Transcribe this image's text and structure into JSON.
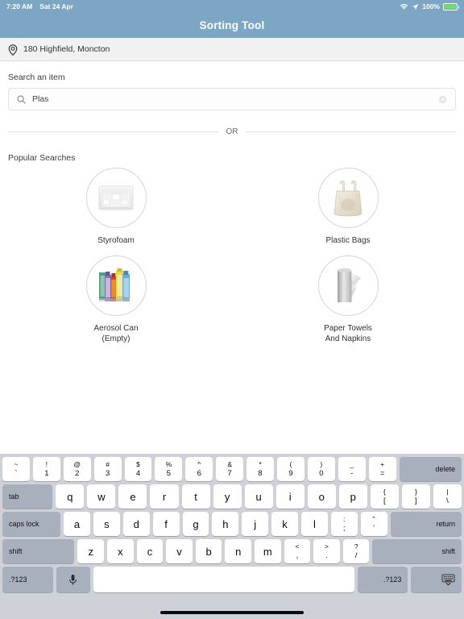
{
  "status_bar": {
    "time": "7:20 AM",
    "date": "Sat 24 Apr",
    "battery_percent": "100%",
    "wifi_icon": "wifi-icon",
    "location_arrow_icon": "location-arrow-icon",
    "battery_icon": "battery-icon"
  },
  "header": {
    "title": "Sorting Tool"
  },
  "address_bar": {
    "icon": "location-pin-icon",
    "text": "180 Highfield, Moncton"
  },
  "search": {
    "label": "Search an item",
    "value": "Plas",
    "placeholder": "Search an item",
    "search_icon": "search-icon",
    "clear_icon": "clear-circle-icon"
  },
  "divider": {
    "text": "OR"
  },
  "popular": {
    "title": "Popular Searches",
    "items": [
      {
        "label": "Styrofoam",
        "icon": "styrofoam-tray-icon"
      },
      {
        "label": "Plastic Bags",
        "icon": "plastic-bag-icon"
      },
      {
        "label": "Aerosol Can\n(Empty)",
        "line1": "Aerosol Can",
        "line2": "(Empty)",
        "icon": "aerosol-cans-icon"
      },
      {
        "label": "Paper Towels\nAnd Napkins",
        "line1": "Paper Towels",
        "line2": "And Napkins",
        "icon": "paper-towel-roll-icon"
      }
    ]
  },
  "keyboard": {
    "row1": [
      {
        "top": "~",
        "bot": "`"
      },
      {
        "top": "!",
        "bot": "1"
      },
      {
        "top": "@",
        "bot": "2"
      },
      {
        "top": "#",
        "bot": "3"
      },
      {
        "top": "$",
        "bot": "4"
      },
      {
        "top": "%",
        "bot": "5"
      },
      {
        "top": "^",
        "bot": "6"
      },
      {
        "top": "&",
        "bot": "7"
      },
      {
        "top": "*",
        "bot": "8"
      },
      {
        "top": "(",
        "bot": "9"
      },
      {
        "top": ")",
        "bot": "0"
      },
      {
        "top": "_",
        "bot": "-"
      },
      {
        "top": "+",
        "bot": "="
      }
    ],
    "delete": "delete",
    "tab": "tab",
    "row2": [
      "q",
      "w",
      "e",
      "r",
      "t",
      "y",
      "u",
      "i",
      "o",
      "p"
    ],
    "row2_dual": [
      {
        "top": "{",
        "bot": "["
      },
      {
        "top": "}",
        "bot": "]"
      },
      {
        "top": "|",
        "bot": "\\"
      }
    ],
    "caps_lock": "caps lock",
    "row3": [
      "a",
      "s",
      "d",
      "f",
      "g",
      "h",
      "j",
      "k",
      "l"
    ],
    "row3_dual": [
      {
        "top": ":",
        "bot": ";"
      },
      {
        "top": "”",
        "bot": "’"
      }
    ],
    "return": "return",
    "shift_left": "shift",
    "row4": [
      "z",
      "x",
      "c",
      "v",
      "b",
      "n",
      "m"
    ],
    "row4_dual": [
      {
        "top": "<",
        "bot": ","
      },
      {
        "top": ">",
        "bot": "."
      },
      {
        "top": "?",
        "bot": "/"
      }
    ],
    "shift_right": "shift",
    "num_left": ".?123",
    "mic_icon": "microphone-icon",
    "space": "",
    "num_right": ".?123",
    "hide_keyboard_icon": "hide-keyboard-icon"
  },
  "colors": {
    "header_blue": "#7da5c4",
    "keyboard_bg": "#ced1d7",
    "modifier_key": "#a9b0bd",
    "key_white": "#ffffff",
    "address_bar_bg": "#f1f1f1",
    "battery_green": "#6ddc7a"
  }
}
